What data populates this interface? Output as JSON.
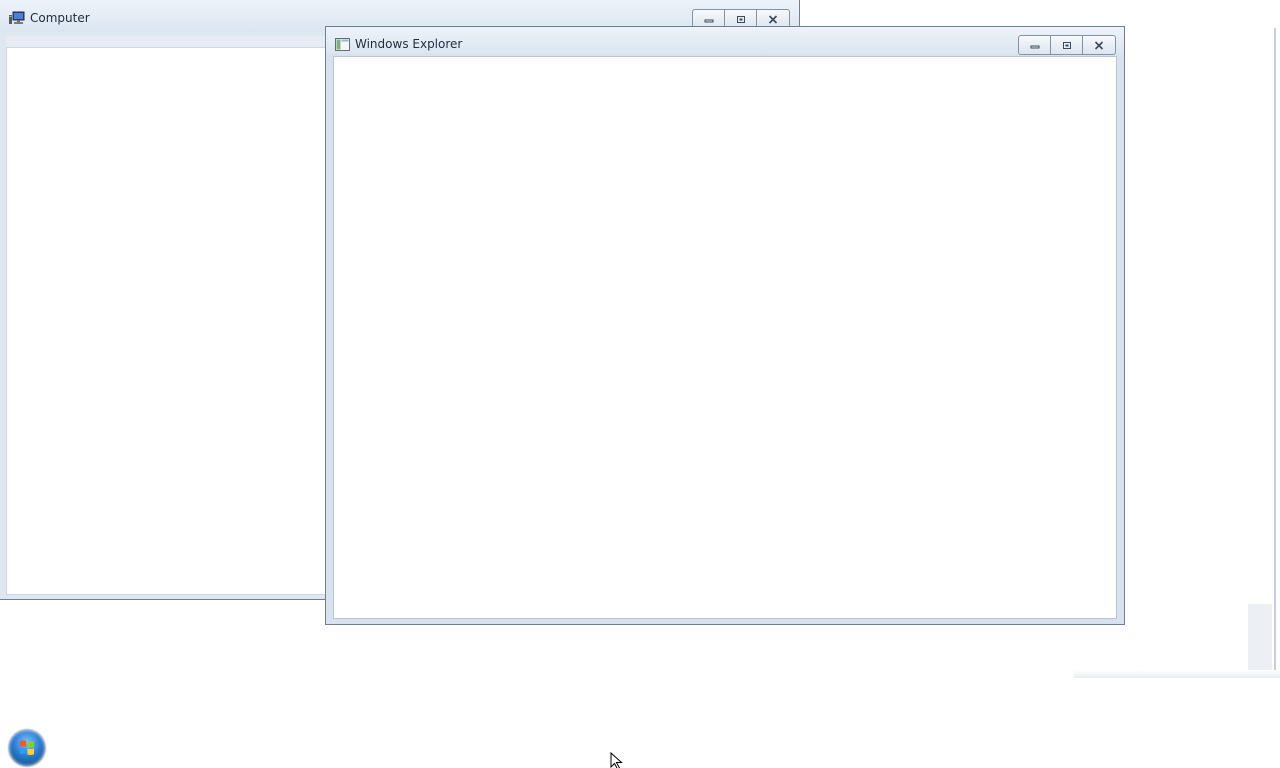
{
  "windows": {
    "computer": {
      "title": "Computer",
      "icon": "computer-icon"
    },
    "explorer": {
      "title": "Windows Explorer",
      "icon": "folder-window-icon"
    }
  },
  "caption_buttons": {
    "minimize": "minimize-icon",
    "maximize": "maximize-icon",
    "close": "close-icon"
  },
  "taskbar": {
    "start_button": "windows-start-orb-icon"
  },
  "colors": {
    "titlebar": "#dbe5f0",
    "frame_border": "#6e7f93",
    "client_bg": "#ffffff"
  }
}
